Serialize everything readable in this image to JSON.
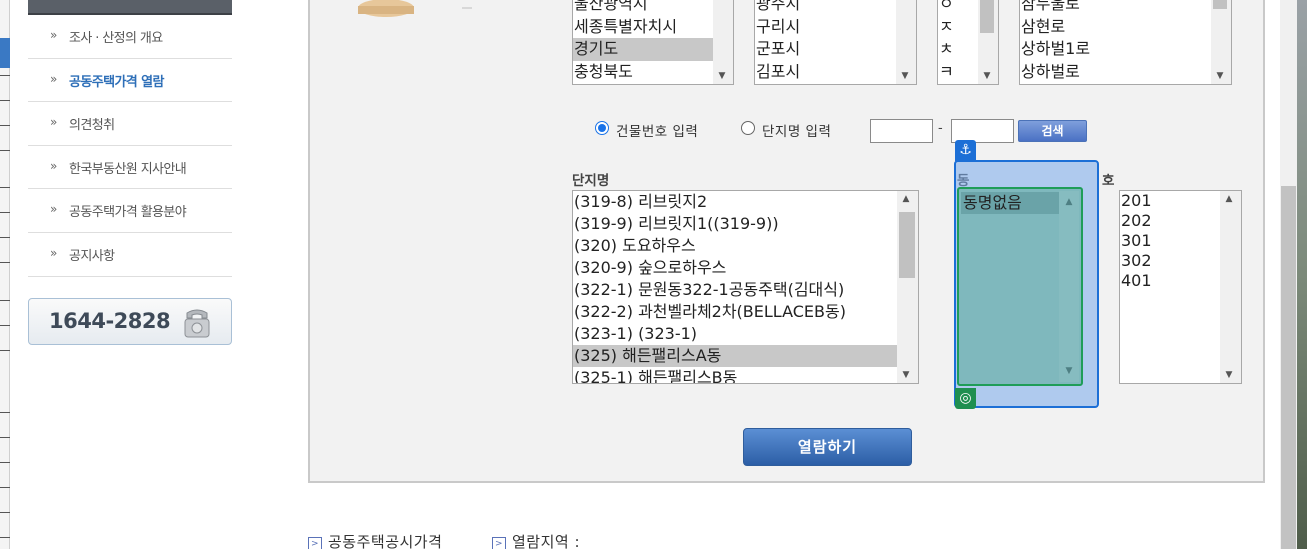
{
  "sidebar": {
    "items": [
      {
        "label": "조사 · 산정의 개요",
        "active": false
      },
      {
        "label": "공동주택가격 열람",
        "active": true
      },
      {
        "label": "의견청취",
        "active": false
      },
      {
        "label": "한국부동산원 지사안내",
        "active": false
      },
      {
        "label": "공동주택가격 활용분야",
        "active": false
      },
      {
        "label": "공지사항",
        "active": false
      }
    ],
    "arrow_glyph": "»",
    "phone": "1644-2828"
  },
  "region_lists": {
    "sido": {
      "options": [
        "울산광역시",
        "세종특별자치시",
        "경기도",
        "충청북도"
      ],
      "selected": "경기도"
    },
    "sigungu": {
      "options": [
        "광주시",
        "구리시",
        "군포시",
        "김포시"
      ]
    },
    "initial": {
      "options": [
        "ㅇ",
        "ㅈ",
        "ㅊ",
        "ㅋ"
      ]
    },
    "road": {
      "options": [
        "삼두울로",
        "삼현로",
        "상하벌1로",
        "상하벌로"
      ]
    }
  },
  "search": {
    "radio_building_no": "건물번호 입력",
    "radio_complex_name": "단지명 입력",
    "selected_mode": "building_no",
    "input_main_value": "",
    "input_sub_value": "",
    "dash": "-",
    "search_button": "검색"
  },
  "complex": {
    "label": "단지명",
    "options": [
      "(319-8) 리브릿지2",
      "(319-9) 리브릿지1((319-9))",
      "(320) 도요하우스",
      "(320-9) 숲으로하우스",
      "(322-1) 문원동322-1공동주택(김대식)",
      "(322-2) 과천벨라체2차(BELLACEB동)",
      "(323-1) (323-1)",
      "(325) 해든팰리스A동",
      "(325-1) 해든팰리스B동"
    ],
    "selected": "(325) 해든팰리스A동"
  },
  "dong": {
    "label": "동",
    "options": [
      "동명없음"
    ],
    "selected": "동명없음"
  },
  "ho": {
    "label": "호",
    "options": [
      "201",
      "202",
      "301",
      "302",
      "401"
    ]
  },
  "view_button": "열람하기",
  "bottom": {
    "link1": "공동주택공시가격",
    "link2": "열람지역 :",
    "link_icon": "arrow-box-icon"
  },
  "colors": {
    "active_menu": "#2e6fb8",
    "button_blue": "#2c5ea6",
    "overlay_outer": "#1c6fd6",
    "overlay_inner": "#1f9d58"
  }
}
